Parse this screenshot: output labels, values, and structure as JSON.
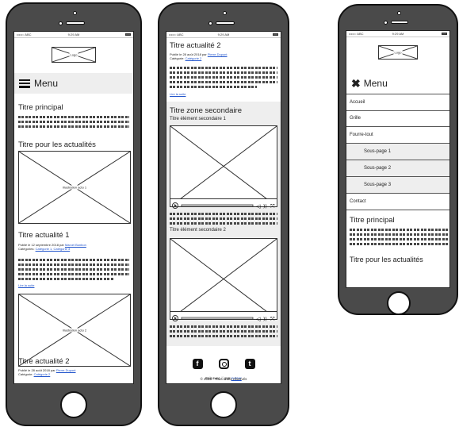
{
  "status": {
    "carrier": "•••••○ ABC",
    "time": "9:29 AM"
  },
  "logo": "Logo",
  "menu": {
    "label": "Menu"
  },
  "main_title": "Titre principal",
  "news_title": "Titre pour les actualités",
  "news": [
    {
      "illustration": "Illustration actu 1",
      "title": "Titre actualité 1",
      "date_line": "Publié le 12 septembre 2018 par",
      "author": "Marcel Bonbon",
      "cat_label": "Catégories:",
      "categories": "Catégorie 1, Catégorie 3",
      "read_more": "Lire la suite"
    },
    {
      "illustration": "Illustration actu 2",
      "title": "Titre actualité 2",
      "date_line": "Publié le 28 août 2018 par",
      "author": "Pierre Dupont",
      "cat_label": "Catégorie:",
      "categories": "Catégorie 2",
      "read_more": "Lire la suite"
    }
  ],
  "secondary": {
    "zone_title": "Titre zone secondaire",
    "element1": "Titre élément secondaire 1",
    "element2": "Titre élément secondaire 2"
  },
  "footer": {
    "made_with": "Fait avec ♡ par",
    "author": "Auteur",
    "rights": "© 2019 - Tous droits réservés"
  },
  "nav": [
    "Accueil",
    "Grille",
    "Fourre-tout",
    "Sous-page 1",
    "Sous-page 2",
    "Sous-page 3",
    "Contact"
  ]
}
